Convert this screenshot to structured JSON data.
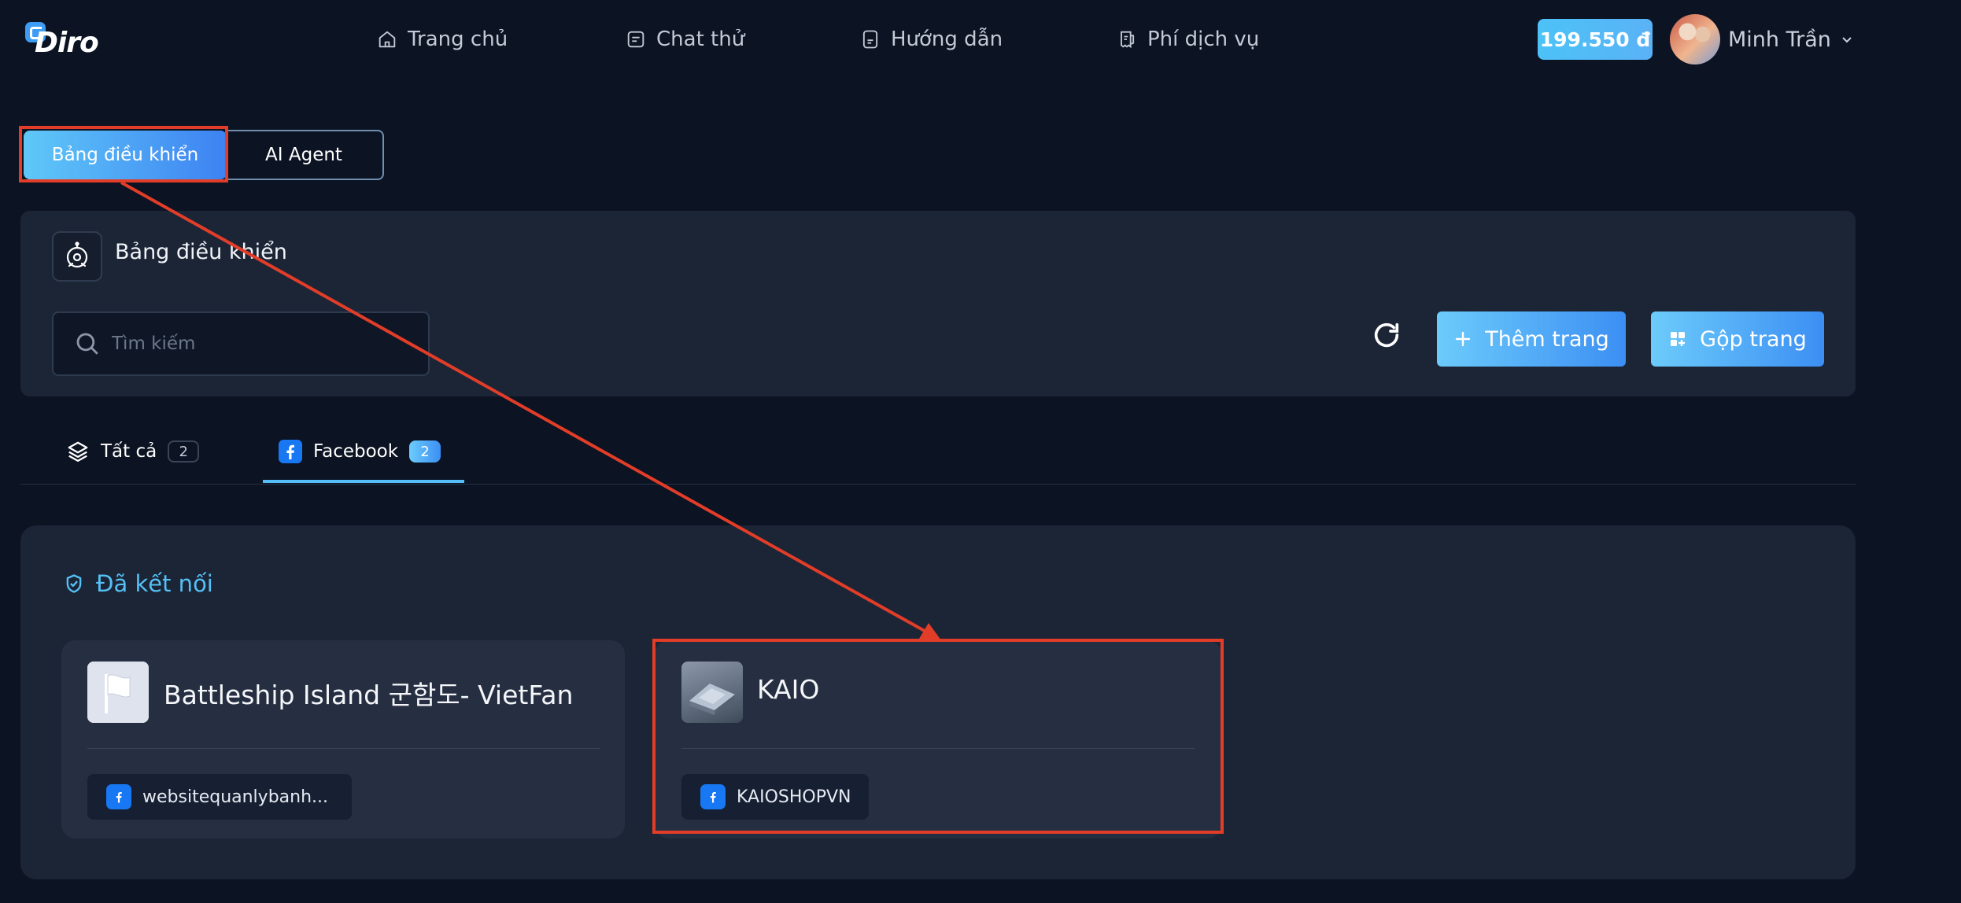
{
  "app": {
    "logo_text": "Diro"
  },
  "nav": {
    "items": [
      {
        "label": "Trang chủ",
        "icon": "home-icon"
      },
      {
        "label": "Chat thử",
        "icon": "chat-icon"
      },
      {
        "label": "Hướng dẫn",
        "icon": "guide-icon"
      },
      {
        "label": "Phí dịch vụ",
        "icon": "fee-icon"
      }
    ],
    "balance": "199.550 đ",
    "user_name": "Minh Trần"
  },
  "mode_tabs": {
    "dashboard": "Bảng điều khiển",
    "agent": "AI Agent"
  },
  "toolbar": {
    "title": "Bảng điều khiển",
    "search_placeholder": "Tìm kiếm",
    "add_page": "Thêm trang",
    "merge_page": "Gộp trang"
  },
  "platform_tabs": [
    {
      "label": "Tất cả",
      "count": "2",
      "icon": "layers-icon"
    },
    {
      "label": "Facebook",
      "count": "2",
      "icon": "facebook-icon",
      "active": true
    }
  ],
  "connected": {
    "title": "Đã kết nối",
    "pages": [
      {
        "name": "Battleship Island 군함도- VietFan",
        "account": "websitequanlybanh..."
      },
      {
        "name": "KAIO",
        "account": "KAIOSHOPVN"
      }
    ]
  },
  "colors": {
    "accent": "#54bcf7",
    "annotation": "#e23d28",
    "facebook": "#1877f2"
  }
}
